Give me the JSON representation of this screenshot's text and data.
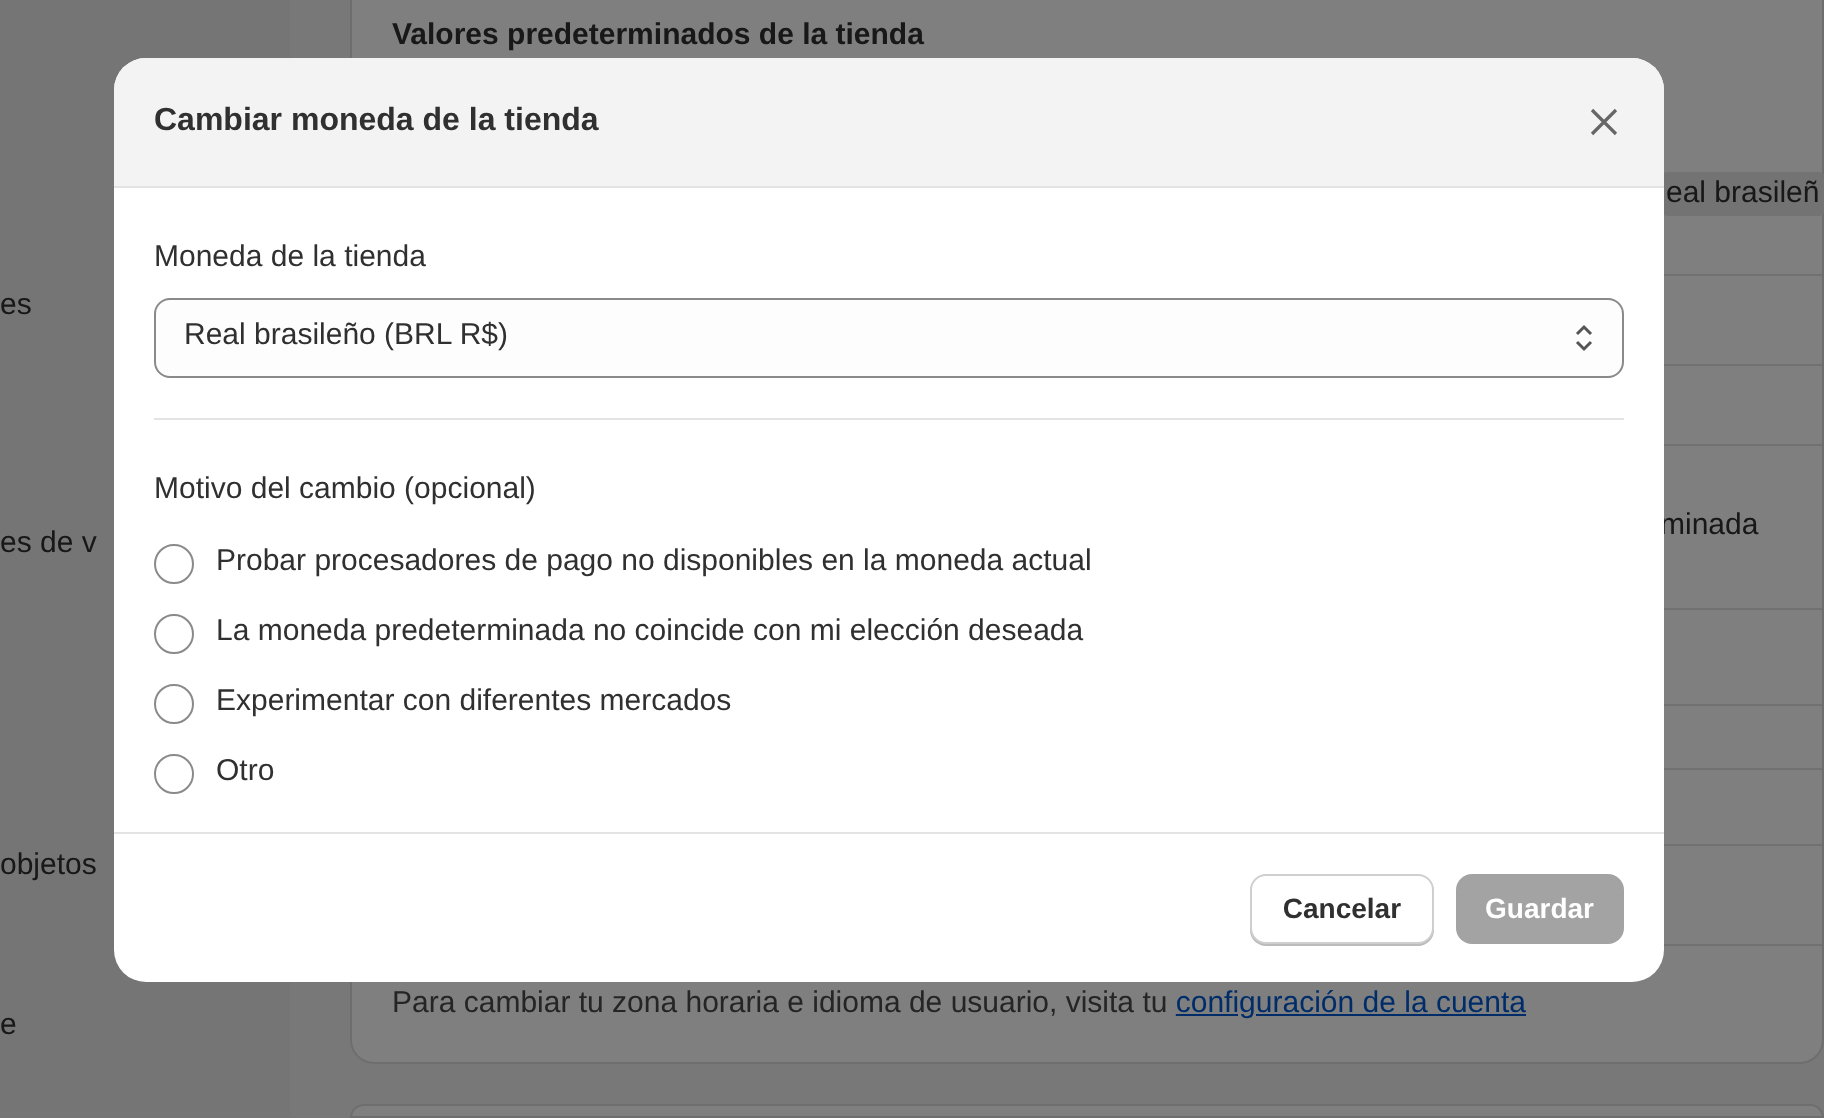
{
  "background": {
    "sidebar_items": [
      "es",
      "es de v",
      "objetos",
      "e"
    ],
    "card": {
      "title": "Valores predeterminados de la tienda",
      "currency_fragment": "eal brasileñ",
      "format_fragment": "minada",
      "footer_text": "Para cambiar tu zona horaria e idioma de usuario, visita tu ",
      "footer_link": "configuración de la cuenta"
    }
  },
  "modal": {
    "title": "Cambiar moneda de la tienda",
    "field_label": "Moneda de la tienda",
    "select_value": "Real brasileño (BRL R$)",
    "reason_label": "Motivo del cambio (opcional)",
    "reasons": [
      {
        "label": "Probar procesadores de pago no disponibles en la moneda actual",
        "selected": false
      },
      {
        "label": "La moneda predeterminada no coincide con mi elección deseada",
        "selected": false
      },
      {
        "label": "Experimentar con diferentes mercados",
        "selected": false
      },
      {
        "label": "Otro",
        "selected": false
      }
    ],
    "buttons": [
      {
        "label": "Cancelar",
        "kind": "secondary",
        "disabled": false
      },
      {
        "label": "Guardar",
        "kind": "primary",
        "disabled": true
      }
    ]
  }
}
